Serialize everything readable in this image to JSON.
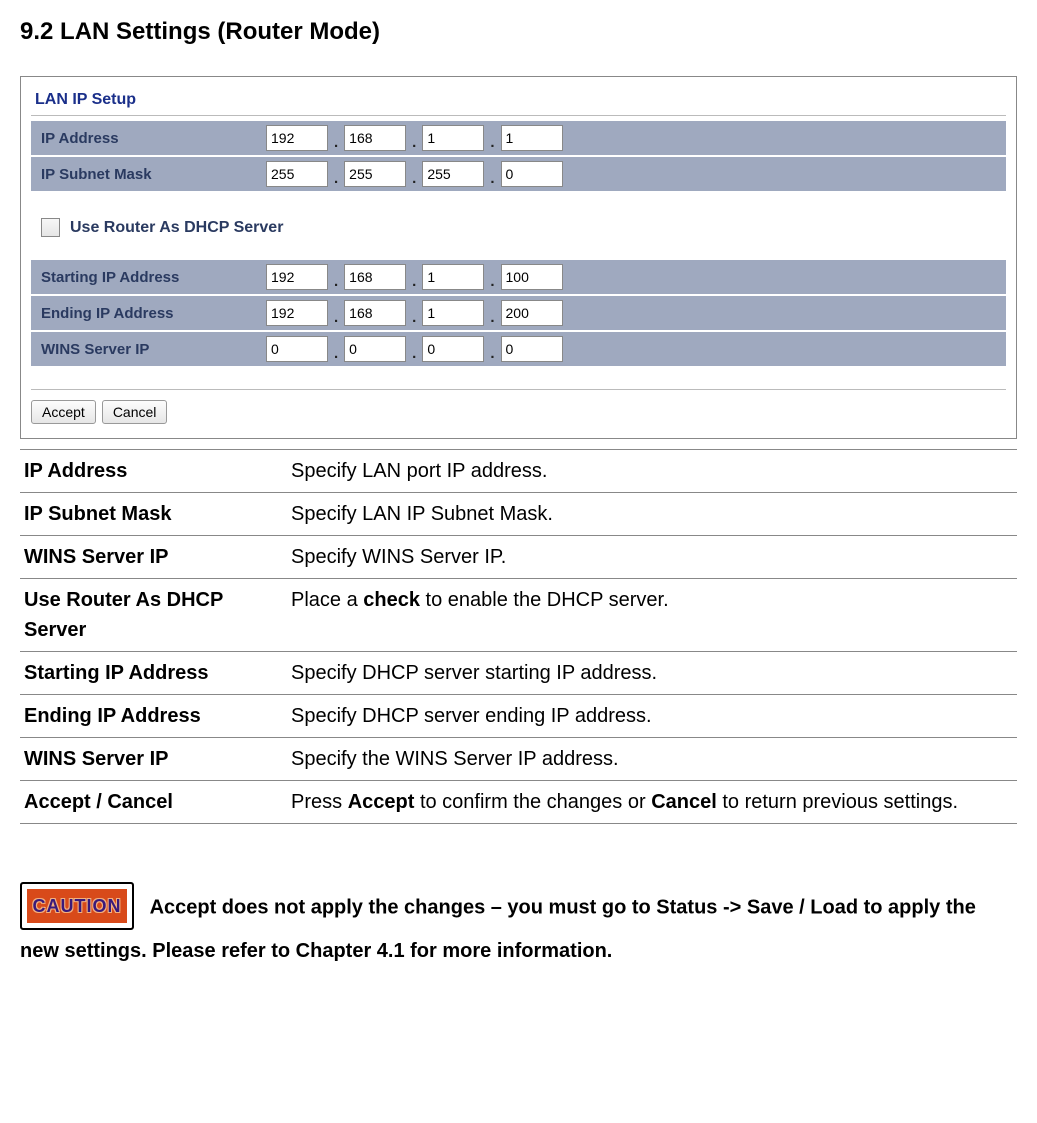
{
  "heading": "9.2 LAN Settings (Router Mode)",
  "panel": {
    "title": "LAN IP Setup",
    "rows1": [
      {
        "label": "IP Address",
        "oct": [
          "192",
          "168",
          "1",
          "1"
        ]
      },
      {
        "label": "IP Subnet Mask",
        "oct": [
          "255",
          "255",
          "255",
          "0"
        ]
      }
    ],
    "checkbox_label": "Use Router As DHCP Server",
    "rows2": [
      {
        "label": "Starting IP Address",
        "oct": [
          "192",
          "168",
          "1",
          "100"
        ]
      },
      {
        "label": "Ending IP Address",
        "oct": [
          "192",
          "168",
          "1",
          "200"
        ]
      },
      {
        "label": "WINS Server IP",
        "oct": [
          "0",
          "0",
          "0",
          "0"
        ]
      }
    ],
    "accept": "Accept",
    "cancel": "Cancel"
  },
  "defs": [
    {
      "term": "IP Address",
      "desc_parts": [
        "Specify LAN port IP address."
      ]
    },
    {
      "term": "IP Subnet Mask",
      "desc_parts": [
        "Specify LAN IP Subnet Mask."
      ]
    },
    {
      "term": "WINS Server IP",
      "desc_parts": [
        "Specify WINS Server IP."
      ]
    },
    {
      "term": "Use Router As DHCP Server",
      "desc_parts": [
        "Place a ",
        {
          "bold": "check"
        },
        " to enable the DHCP server."
      ]
    },
    {
      "term": "Starting IP Address",
      "desc_parts": [
        "Specify DHCP server starting IP address."
      ]
    },
    {
      "term": "Ending IP Address",
      "desc_parts": [
        "Specify DHCP server ending IP address."
      ]
    },
    {
      "term": "WINS Server IP",
      "desc_parts": [
        "Specify the WINS Server IP address."
      ]
    },
    {
      "term": "Accept / Cancel",
      "desc_parts": [
        "Press ",
        {
          "bold": "Accept"
        },
        " to confirm the changes or ",
        {
          "bold": "Cancel"
        },
        " to return previous settings."
      ]
    }
  ],
  "caution": {
    "badge": "CAUTION",
    "text": "Accept does not apply the changes – you must go to Status -> Save / Load to apply the new settings. Please refer to Chapter 4.1 for more information."
  }
}
